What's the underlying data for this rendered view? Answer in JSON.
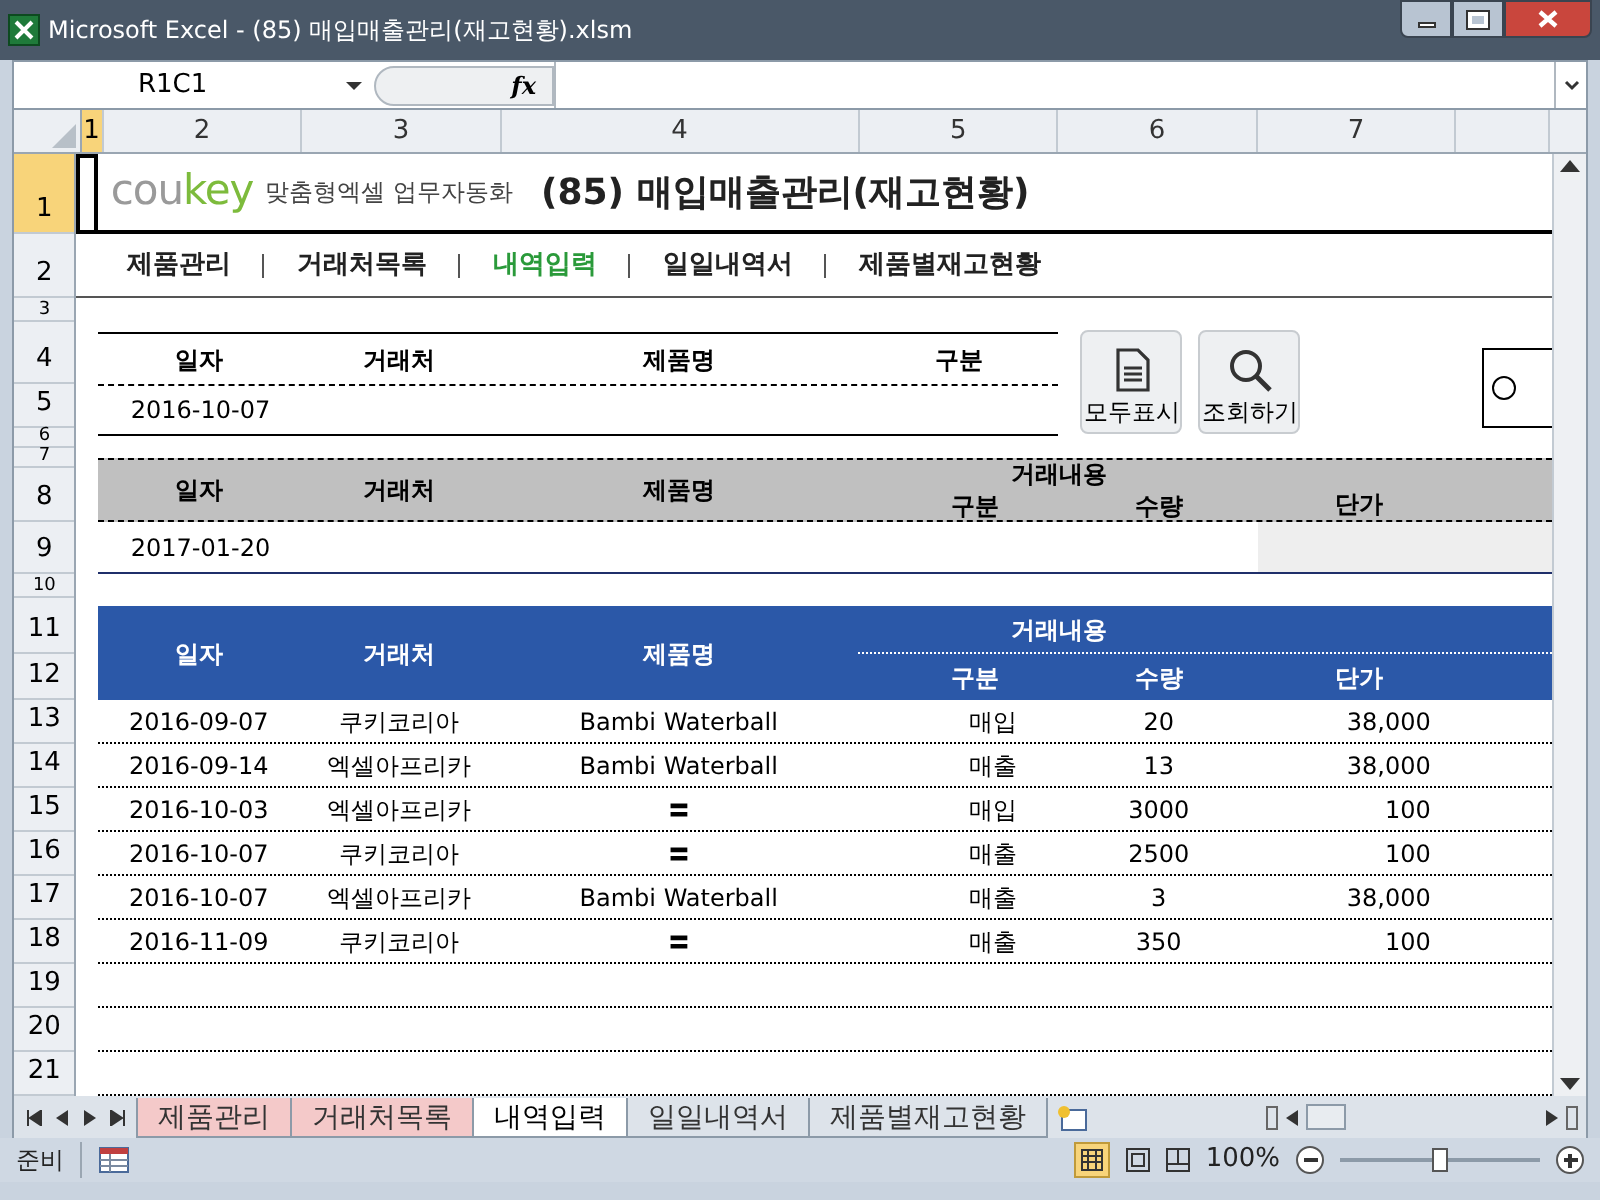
{
  "window": {
    "title": "Microsoft Excel - (85) 매입매출관리(재고현황).xlsm"
  },
  "formula_bar": {
    "name_box": "R1C1",
    "fx": "fx"
  },
  "columns": [
    {
      "label": "1",
      "selected": true
    },
    {
      "label": "2",
      "selected": false
    },
    {
      "label": "3",
      "selected": false
    },
    {
      "label": "4",
      "selected": false
    },
    {
      "label": "5",
      "selected": false
    },
    {
      "label": "6",
      "selected": false
    },
    {
      "label": "7",
      "selected": false
    }
  ],
  "rows": [
    {
      "label": "1",
      "selected": true
    },
    {
      "label": "2",
      "selected": false
    },
    {
      "label": "3",
      "selected": false
    },
    {
      "label": "4",
      "selected": false
    },
    {
      "label": "5",
      "selected": false
    },
    {
      "label": "6",
      "selected": false
    },
    {
      "label": "7",
      "selected": false
    },
    {
      "label": "8",
      "selected": false
    },
    {
      "label": "9",
      "selected": false
    },
    {
      "label": "10",
      "selected": false
    },
    {
      "label": "11",
      "selected": false
    },
    {
      "label": "12",
      "selected": false
    },
    {
      "label": "13",
      "selected": false
    },
    {
      "label": "14",
      "selected": false
    },
    {
      "label": "15",
      "selected": false
    },
    {
      "label": "16",
      "selected": false
    },
    {
      "label": "17",
      "selected": false
    },
    {
      "label": "18",
      "selected": false
    },
    {
      "label": "19",
      "selected": false
    },
    {
      "label": "20",
      "selected": false
    },
    {
      "label": "21",
      "selected": false
    }
  ],
  "logo": [
    "cou",
    "key"
  ],
  "tagline": "맞춤형엑셀 업무자동화",
  "title": "(85) 매입매출관리(재고현황)",
  "nav": [
    {
      "label": "제품관리",
      "selected": false
    },
    {
      "label": "거래처목록",
      "selected": false
    },
    {
      "label": "내역입력",
      "selected": true
    },
    {
      "label": "일일내역서",
      "selected": false
    },
    {
      "label": "제품별재고현황",
      "selected": false
    }
  ],
  "search": {
    "headers": [
      "일자",
      "거래처",
      "제품명",
      "구분"
    ],
    "date": "2016-10-07"
  },
  "option": {
    "checked": false
  },
  "buttons": [
    {
      "kind": "document",
      "label": "모두표시"
    },
    {
      "kind": "search",
      "label": "조회하기"
    }
  ],
  "entry": {
    "headers": [
      "일자",
      "거래처",
      "제품명"
    ],
    "group": "거래내용",
    "sub_headers": [
      "구분",
      "수량"
    ],
    "price_header": "단가",
    "date": "2017-01-20"
  },
  "table": {
    "headers": [
      "일자",
      "거래처",
      "제품명"
    ],
    "group": "거래내용",
    "sub_headers": [
      "구분",
      "수량",
      "단가"
    ],
    "rows": [
      [
        "2016-09-07",
        "쿠키코리아",
        "Bambi Waterball",
        "매입",
        "20",
        "38,000"
      ],
      [
        "2016-09-14",
        "엑셀아프리카",
        "Bambi Waterball",
        "매출",
        "13",
        "38,000"
      ],
      [
        "2016-10-03",
        "엑셀아프리카",
        "〓",
        "매입",
        "3000",
        "100"
      ],
      [
        "2016-10-07",
        "쿠키코리아",
        "〓",
        "매출",
        "2500",
        "100"
      ],
      [
        "2016-10-07",
        "엑셀아프리카",
        "Bambi Waterball",
        "매출",
        "3",
        "38,000"
      ],
      [
        "2016-11-09",
        "쿠키코리아",
        "〓",
        "매출",
        "350",
        "100"
      ]
    ]
  },
  "sheet_tabs": [
    {
      "label": "제품관리",
      "selected": false,
      "color": "#f4c9c9"
    },
    {
      "label": "거래처목록",
      "selected": false,
      "color": "#f4c9c9"
    },
    {
      "label": "내역입력",
      "selected": true
    },
    {
      "label": "일일내역서",
      "selected": false
    },
    {
      "label": "제품별재고현황",
      "selected": false
    }
  ],
  "status_bar": {
    "mode": "준비",
    "zoom": "100%",
    "zoom_slider": {
      "level": 0.5
    }
  }
}
